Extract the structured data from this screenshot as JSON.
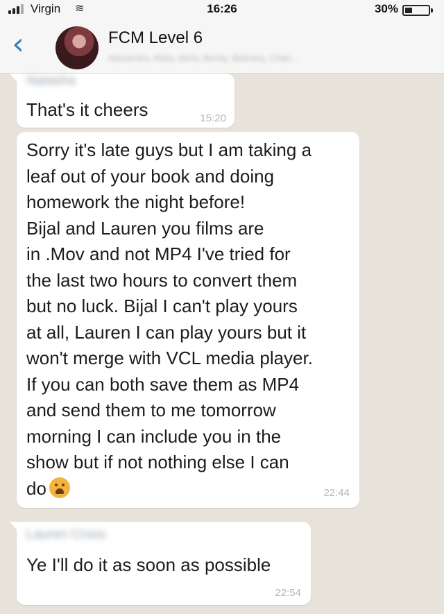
{
  "status_bar": {
    "carrier": "Virgin",
    "time": "16:26",
    "battery": "30%",
    "battery_level": 0.3
  },
  "header": {
    "back_icon": "chevron-left-icon",
    "title": "FCM Level 6",
    "participants": "Alexandra, Abby, Akira, Becky, Bethany, Chan..."
  },
  "messages": [
    {
      "sender": "Natasha",
      "text": "That's it cheers",
      "time": "15:20"
    },
    {
      "sender": "",
      "text": "Sorry it's late guys but I am taking a\nleaf out of your book and doing\nhomework the night before!\nBijal and Lauren you films are\nin .Mov and not MP4 I've tried for\nthe last two hours to convert them\nbut no luck. Bijal I can't play yours\nat all, Lauren I can play yours but it\nwon't merge with VCL media player.\nIf you can both save them as MP4\nand send them to me tomorrow\nmorning I can include you in the\nshow but if not nothing else I can\ndo",
      "emoji": "weary-face-emoji",
      "time": "22:44"
    },
    {
      "sender": "Lauren Cross",
      "text": "Ye I'll do it as soon as possible",
      "time": "22:54"
    }
  ],
  "colors": {
    "background": "#e7e2da",
    "bubble": "#ffffff",
    "accent": "#2d7fbf"
  }
}
